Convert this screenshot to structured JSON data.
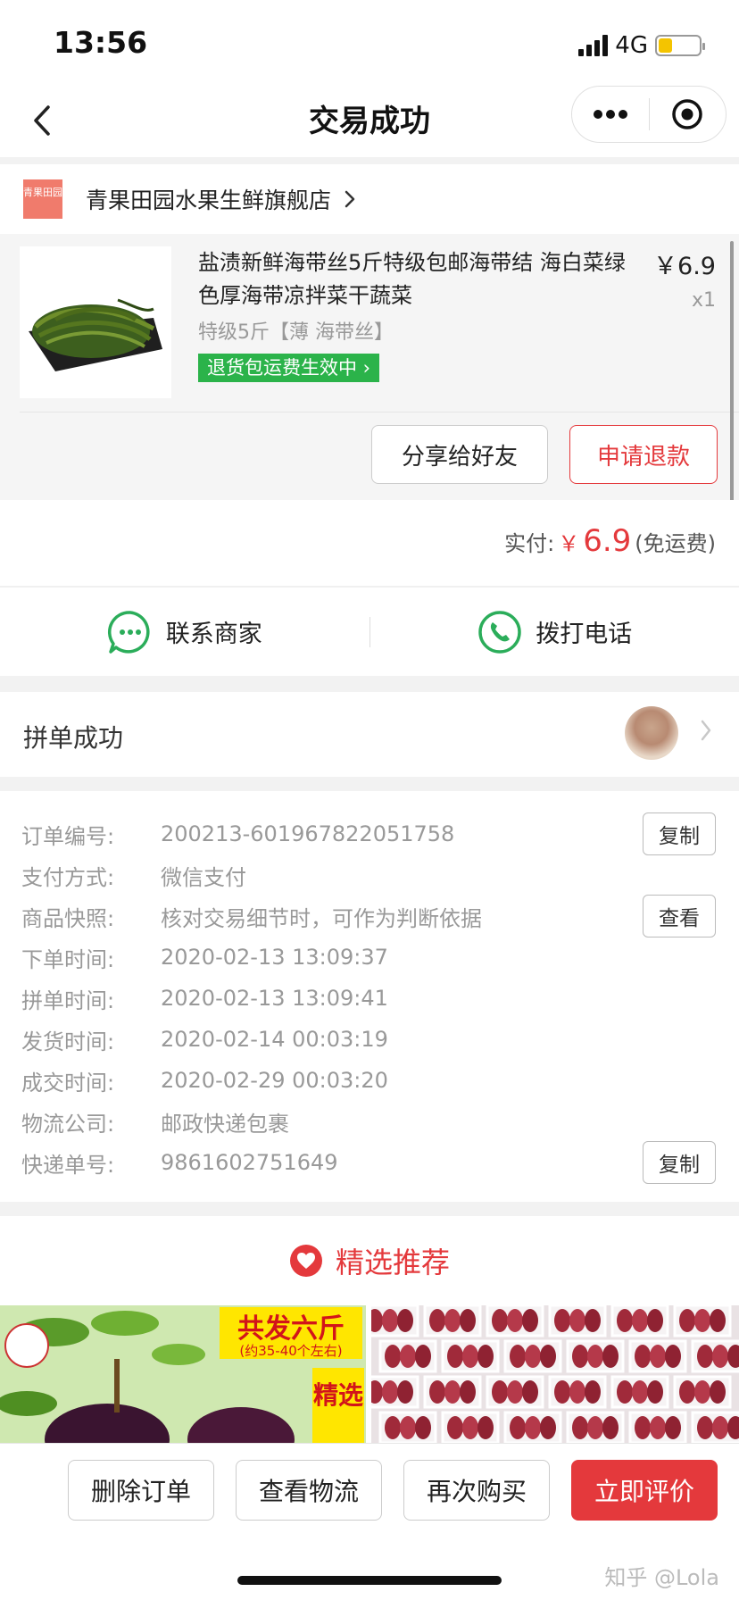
{
  "status_bar": {
    "time": "13:56",
    "network": "4G",
    "battery_level": 0.35
  },
  "nav": {
    "title": "交易成功"
  },
  "store": {
    "logo_text": "青果田园",
    "name": "青果田园水果生鲜旗舰店"
  },
  "item": {
    "title": "盐渍新鲜海带丝5斤特级包邮海带结 海白菜绿色厚海带凉拌菜干蔬菜",
    "price": "￥6.9",
    "quantity": "x1",
    "spec": "特级5斤【薄 海带丝】",
    "tag": "退货包运费生效中",
    "share_label": "分享给好友",
    "refund_label": "申请退款"
  },
  "payment": {
    "label": "实付:",
    "currency": "￥",
    "amount": "6.9",
    "note": "(免运费)"
  },
  "contact": {
    "merchant_label": "联系商家",
    "call_label": "拨打电话"
  },
  "group": {
    "label": "拼单成功"
  },
  "order_info": {
    "rows": [
      {
        "key": "订单编号:",
        "value": "200213-601967822051758",
        "action": "复制"
      },
      {
        "key": "支付方式:",
        "value": "微信支付"
      },
      {
        "key": "商品快照:",
        "value": "核对交易细节时，可作为判断依据",
        "action": "查看"
      },
      {
        "key": "下单时间:",
        "value": "2020-02-13 13:09:37"
      },
      {
        "key": "拼单时间:",
        "value": "2020-02-13 13:09:41"
      },
      {
        "key": "发货时间:",
        "value": "2020-02-14 00:03:19"
      },
      {
        "key": "成交时间:",
        "value": "2020-02-29 00:03:20"
      },
      {
        "key": "物流公司:",
        "value": "邮政快递包裹"
      },
      {
        "key": "快递单号:",
        "value": "9861602751649",
        "action": "复制"
      }
    ]
  },
  "recommend": {
    "title": "精选推荐",
    "banner_1": {
      "headline": "共发六斤",
      "sub": "(约35-40个左右)",
      "badge": "精选"
    }
  },
  "bottom_actions": {
    "delete": "删除订单",
    "logistics": "查看物流",
    "rebuy": "再次购买",
    "review": "立即评价"
  },
  "watermark": "知乎 @Lola",
  "colors": {
    "accent": "#e4393c",
    "green_tag": "#2bb34a",
    "icon_green": "#2bad5a"
  }
}
